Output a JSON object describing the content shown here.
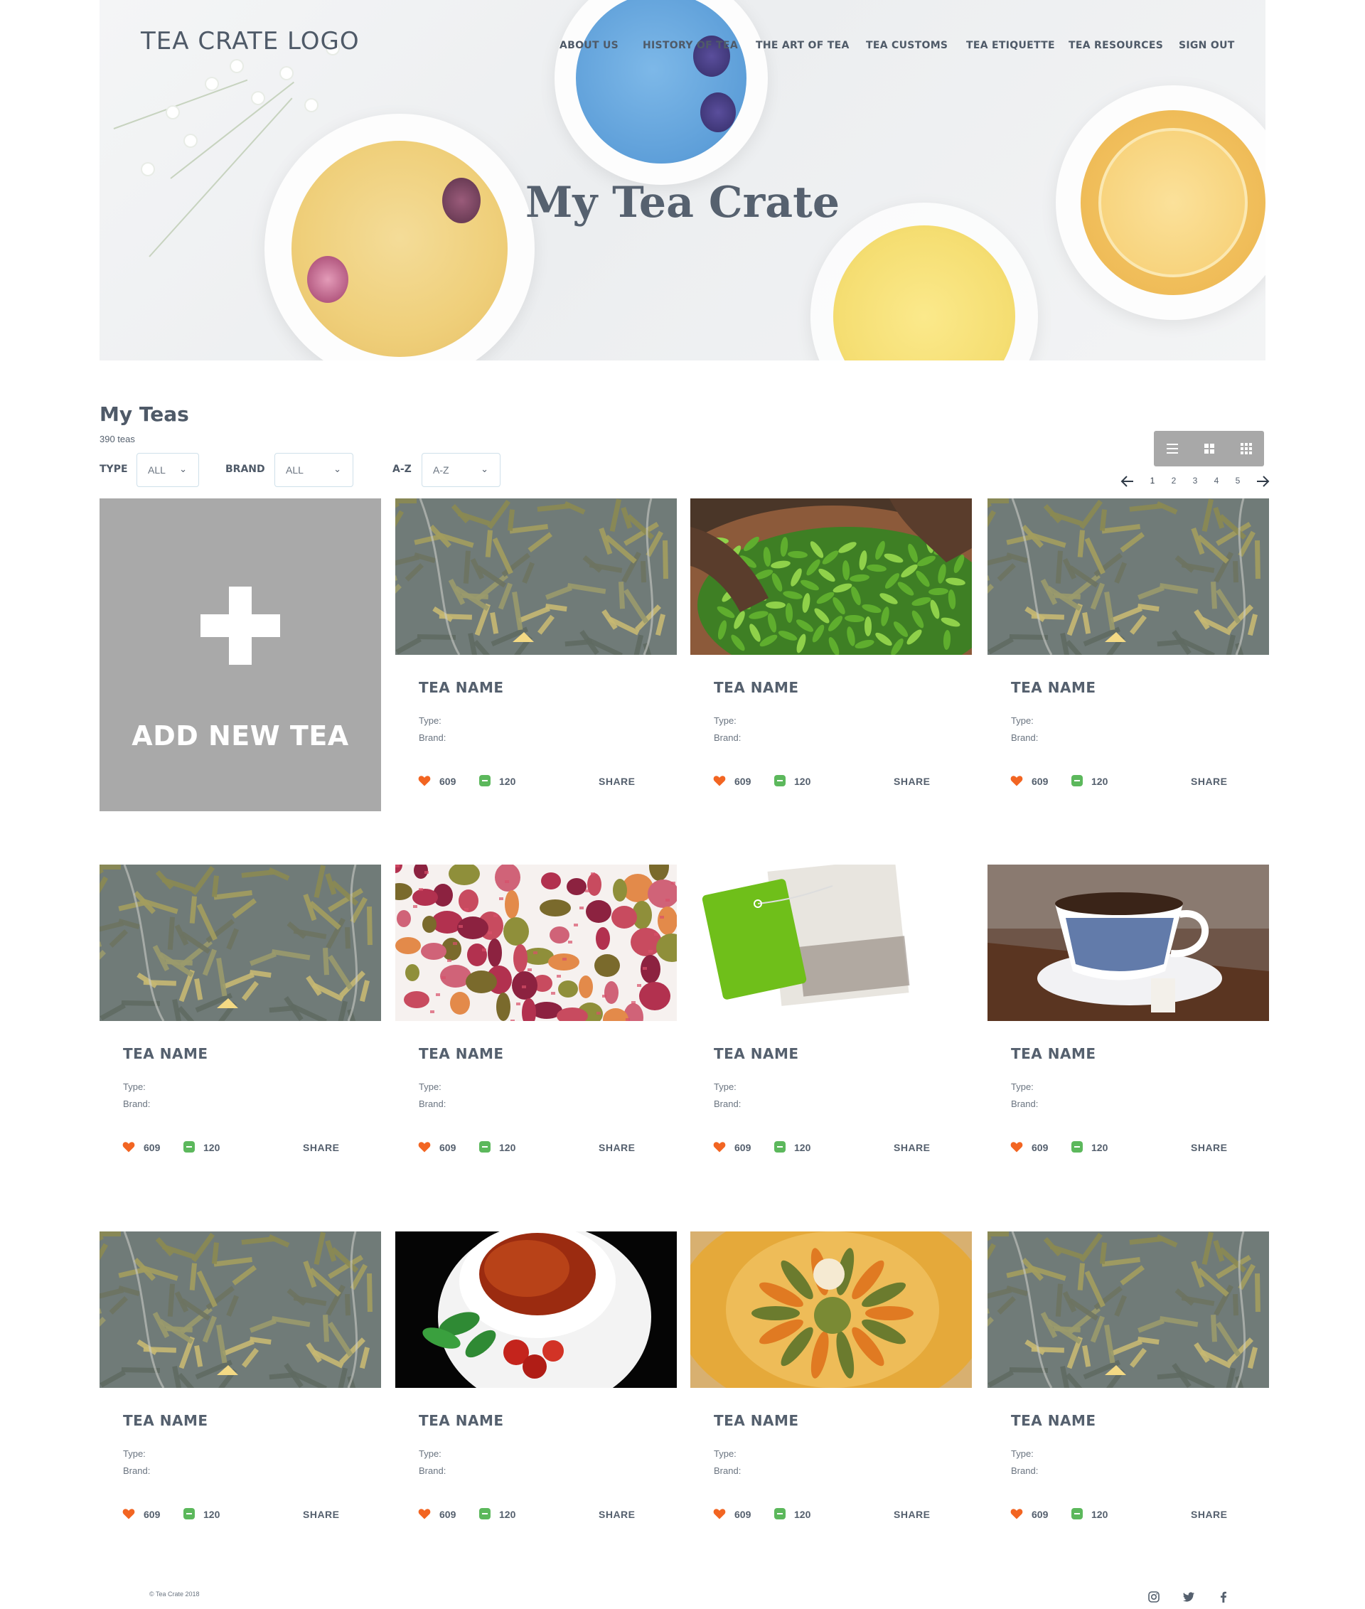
{
  "header": {
    "logo": "TEA CRATE LOGO",
    "nav": [
      "ABOUT US",
      "HISTORY OF TEA",
      "THE ART OF TEA",
      "TEA CUSTOMS",
      "TEA ETIQUETTE",
      "TEA RESOURCES",
      "SIGN OUT"
    ],
    "hero_title": "My Tea Crate"
  },
  "section": {
    "title": "My Teas",
    "count": "390 teas"
  },
  "filters": {
    "type": {
      "label": "TYPE",
      "value": "ALL"
    },
    "brand": {
      "label": "BRAND",
      "value": "ALL"
    },
    "sort": {
      "label": "A-Z",
      "value": "A-Z"
    }
  },
  "pagination": {
    "pages": [
      "1",
      "2",
      "3",
      "4",
      "5"
    ],
    "current": "1"
  },
  "add_card": {
    "label": "ADD NEW TEA"
  },
  "card_labels": {
    "type": "Type:",
    "brand": "Brand:",
    "share": "SHARE"
  },
  "teas": [
    {
      "name": "TEA NAME",
      "likes": "609",
      "comments": "120",
      "image": "loose-leaf-green-tea"
    },
    {
      "name": "TEA NAME",
      "likes": "609",
      "comments": "120",
      "image": "fresh-tea-leaves-in-hands"
    },
    {
      "name": "TEA NAME",
      "likes": "609",
      "comments": "120",
      "image": "loose-leaf-green-tea"
    },
    {
      "name": "TEA NAME",
      "likes": "609",
      "comments": "120",
      "image": "loose-leaf-green-tea"
    },
    {
      "name": "TEA NAME",
      "likes": "609",
      "comments": "120",
      "image": "dried-rose-buds"
    },
    {
      "name": "TEA NAME",
      "likes": "609",
      "comments": "120",
      "image": "tea-bag"
    },
    {
      "name": "TEA NAME",
      "likes": "609",
      "comments": "120",
      "image": "blue-china-teacup"
    },
    {
      "name": "TEA NAME",
      "likes": "609",
      "comments": "120",
      "image": "loose-leaf-green-tea"
    },
    {
      "name": "TEA NAME",
      "likes": "609",
      "comments": "120",
      "image": "rosehip-tea-cup"
    },
    {
      "name": "TEA NAME",
      "likes": "609",
      "comments": "120",
      "image": "blooming-tea-teapot"
    },
    {
      "name": "TEA NAME",
      "likes": "609",
      "comments": "120",
      "image": "loose-leaf-green-tea"
    }
  ],
  "footer": {
    "copyright": "© Tea Crate 2018",
    "social": [
      "instagram-icon",
      "twitter-icon",
      "facebook-icon"
    ]
  },
  "colors": {
    "like": "#f26522",
    "comment": "#5cb85c",
    "text": "#55606e",
    "add_card_bg": "#a9a9a9"
  }
}
